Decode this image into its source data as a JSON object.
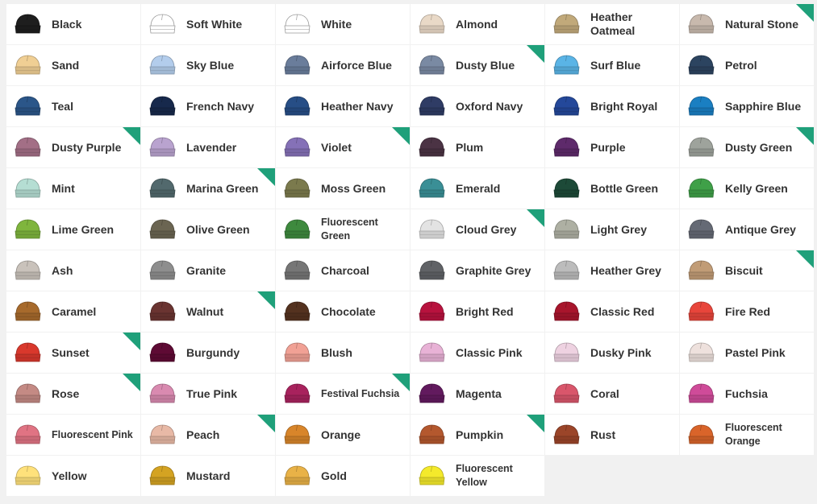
{
  "colours": [
    {
      "name": "Black",
      "hex": "#1e1e1e",
      "new": false
    },
    {
      "name": "Soft White",
      "hex": "#ffffff",
      "new": false
    },
    {
      "name": "White",
      "hex": "#ffffff",
      "new": false
    },
    {
      "name": "Almond",
      "hex": "#e9d9c7",
      "new": false
    },
    {
      "name": "Heather\nOatmeal",
      "hex": "#c1a97a",
      "new": false
    },
    {
      "name": "Natural Stone",
      "hex": "#c8b9ad",
      "new": true
    },
    {
      "name": "Sand",
      "hex": "#f0cf94",
      "new": false
    },
    {
      "name": "Sky Blue",
      "hex": "#b3cdec",
      "new": false
    },
    {
      "name": "Airforce Blue",
      "hex": "#6a7d9b",
      "new": false
    },
    {
      "name": "Dusty Blue",
      "hex": "#7a8aa3",
      "new": true
    },
    {
      "name": "Surf Blue",
      "hex": "#5ab4e6",
      "new": false
    },
    {
      "name": "Petrol",
      "hex": "#2c4460",
      "new": false
    },
    {
      "name": "Teal",
      "hex": "#2b5689",
      "new": false
    },
    {
      "name": "French Navy",
      "hex": "#17294c",
      "new": false
    },
    {
      "name": "Heather Navy",
      "hex": "#274e86",
      "new": false
    },
    {
      "name": "Oxford Navy",
      "hex": "#2f3c65",
      "new": false
    },
    {
      "name": "Bright Royal",
      "hex": "#24489a",
      "new": false
    },
    {
      "name": "Sapphire Blue",
      "hex": "#1a7fc2",
      "new": false
    },
    {
      "name": "Dusty Purple",
      "hex": "#a36f86",
      "new": true
    },
    {
      "name": "Lavender",
      "hex": "#b9a3cf",
      "new": false
    },
    {
      "name": "Violet",
      "hex": "#8571b7",
      "new": true
    },
    {
      "name": "Plum",
      "hex": "#4b3344",
      "new": false
    },
    {
      "name": "Purple",
      "hex": "#5e2a6b",
      "new": false
    },
    {
      "name": "Dusty Green",
      "hex": "#9ea39c",
      "new": true
    },
    {
      "name": "Mint",
      "hex": "#b5ded3",
      "new": false
    },
    {
      "name": "Marina Green",
      "hex": "#52696d",
      "new": true
    },
    {
      "name": "Moss Green",
      "hex": "#7b7a4d",
      "new": false
    },
    {
      "name": "Emerald",
      "hex": "#3a8f96",
      "new": false
    },
    {
      "name": "Bottle Green",
      "hex": "#1d4a38",
      "new": false
    },
    {
      "name": "Kelly Green",
      "hex": "#3fa048",
      "new": false
    },
    {
      "name": "Lime Green",
      "hex": "#7fb53d",
      "new": false
    },
    {
      "name": "Olive Green",
      "hex": "#6b6552",
      "new": false
    },
    {
      "name": "Fluorescent\nGreen",
      "hex": "#3e8a3e",
      "new": false
    },
    {
      "name": "Cloud Grey",
      "hex": "#e3e3e3",
      "new": true
    },
    {
      "name": "Light Grey",
      "hex": "#aeb0a3",
      "new": false
    },
    {
      "name": "Antique Grey",
      "hex": "#656a75",
      "new": false
    },
    {
      "name": "Ash",
      "hex": "#c9c2bb",
      "new": false
    },
    {
      "name": "Granite",
      "hex": "#8e8e8e",
      "new": false
    },
    {
      "name": "Charcoal",
      "hex": "#767676",
      "new": false
    },
    {
      "name": "Graphite Grey",
      "hex": "#606266",
      "new": false
    },
    {
      "name": "Heather Grey",
      "hex": "#bcbcbc",
      "new": false
    },
    {
      "name": "Biscuit",
      "hex": "#c19c76",
      "new": true
    },
    {
      "name": "Caramel",
      "hex": "#a76a2c",
      "new": false
    },
    {
      "name": "Walnut",
      "hex": "#6a3431",
      "new": true
    },
    {
      "name": "Chocolate",
      "hex": "#54321f",
      "new": false
    },
    {
      "name": "Bright Red",
      "hex": "#b8123e",
      "new": false
    },
    {
      "name": "Classic Red",
      "hex": "#a8152c",
      "new": false
    },
    {
      "name": "Fire Red",
      "hex": "#e8453b",
      "new": false
    },
    {
      "name": "Sunset",
      "hex": "#d9382c",
      "new": true
    },
    {
      "name": "Burgundy",
      "hex": "#5e0a34",
      "new": false
    },
    {
      "name": "Blush",
      "hex": "#f1a195",
      "new": false
    },
    {
      "name": "Classic Pink",
      "hex": "#e8b2d6",
      "new": false
    },
    {
      "name": "Dusky Pink",
      "hex": "#eed2e1",
      "new": false
    },
    {
      "name": "Pastel Pink",
      "hex": "#eee1dd",
      "new": false
    },
    {
      "name": "Rose",
      "hex": "#c48a84",
      "new": true
    },
    {
      "name": "True Pink",
      "hex": "#d98ab0",
      "new": false
    },
    {
      "name": "Festival Fuchsia",
      "hex": "#a8225d",
      "new": true
    },
    {
      "name": "Magenta",
      "hex": "#621a5e",
      "new": false
    },
    {
      "name": "Coral",
      "hex": "#d9566b",
      "new": false
    },
    {
      "name": "Fuchsia",
      "hex": "#cf4b99",
      "new": false
    },
    {
      "name": "Fluorescent Pink",
      "hex": "#e07383",
      "new": false
    },
    {
      "name": "Peach",
      "hex": "#e8b9a6",
      "new": true
    },
    {
      "name": "Orange",
      "hex": "#d8852a",
      "new": false
    },
    {
      "name": "Pumpkin",
      "hex": "#b4582e",
      "new": true
    },
    {
      "name": "Rust",
      "hex": "#9b4529",
      "new": false
    },
    {
      "name": "Fluorescent\nOrange",
      "hex": "#d9642a",
      "new": false
    },
    {
      "name": "Yellow",
      "hex": "#ffe17b",
      "new": false
    },
    {
      "name": "Mustard",
      "hex": "#d4a322",
      "new": false
    },
    {
      "name": "Gold",
      "hex": "#e9b247",
      "new": false
    },
    {
      "name": "Fluorescent\nYellow",
      "hex": "#f4ea2b",
      "new": false
    }
  ]
}
